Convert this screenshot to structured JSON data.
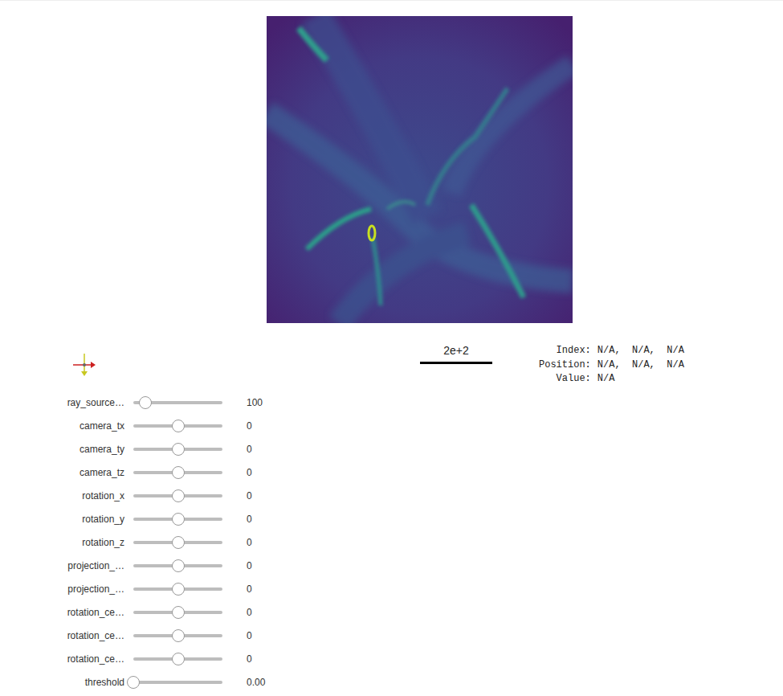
{
  "viewer": {
    "scale_bar": "2e+2",
    "info": [
      {
        "label": "Index:",
        "value": "N/A,  N/A,  N/A"
      },
      {
        "label": "Position:",
        "value": "N/A,  N/A,  N/A"
      },
      {
        "label": "Value:",
        "value": "N/A"
      }
    ]
  },
  "sliders": [
    {
      "label": "ray_source…",
      "value": "100",
      "level": 0.135
    },
    {
      "label": "camera_tx",
      "value": "0",
      "level": 0.5
    },
    {
      "label": "camera_ty",
      "value": "0",
      "level": 0.5
    },
    {
      "label": "camera_tz",
      "value": "0",
      "level": 0.5
    },
    {
      "label": "rotation_x",
      "value": "0",
      "level": 0.5
    },
    {
      "label": "rotation_y",
      "value": "0",
      "level": 0.5
    },
    {
      "label": "rotation_z",
      "value": "0",
      "level": 0.5
    },
    {
      "label": "projection_…",
      "value": "0",
      "level": 0.5
    },
    {
      "label": "projection_…",
      "value": "0",
      "level": 0.5
    },
    {
      "label": "rotation_ce…",
      "value": "0",
      "level": 0.5
    },
    {
      "label": "rotation_ce…",
      "value": "0",
      "level": 0.5
    },
    {
      "label": "rotation_ce…",
      "value": "0",
      "level": 0.5
    },
    {
      "label": "threshold",
      "value": "0.00",
      "level": 0.0
    }
  ]
}
